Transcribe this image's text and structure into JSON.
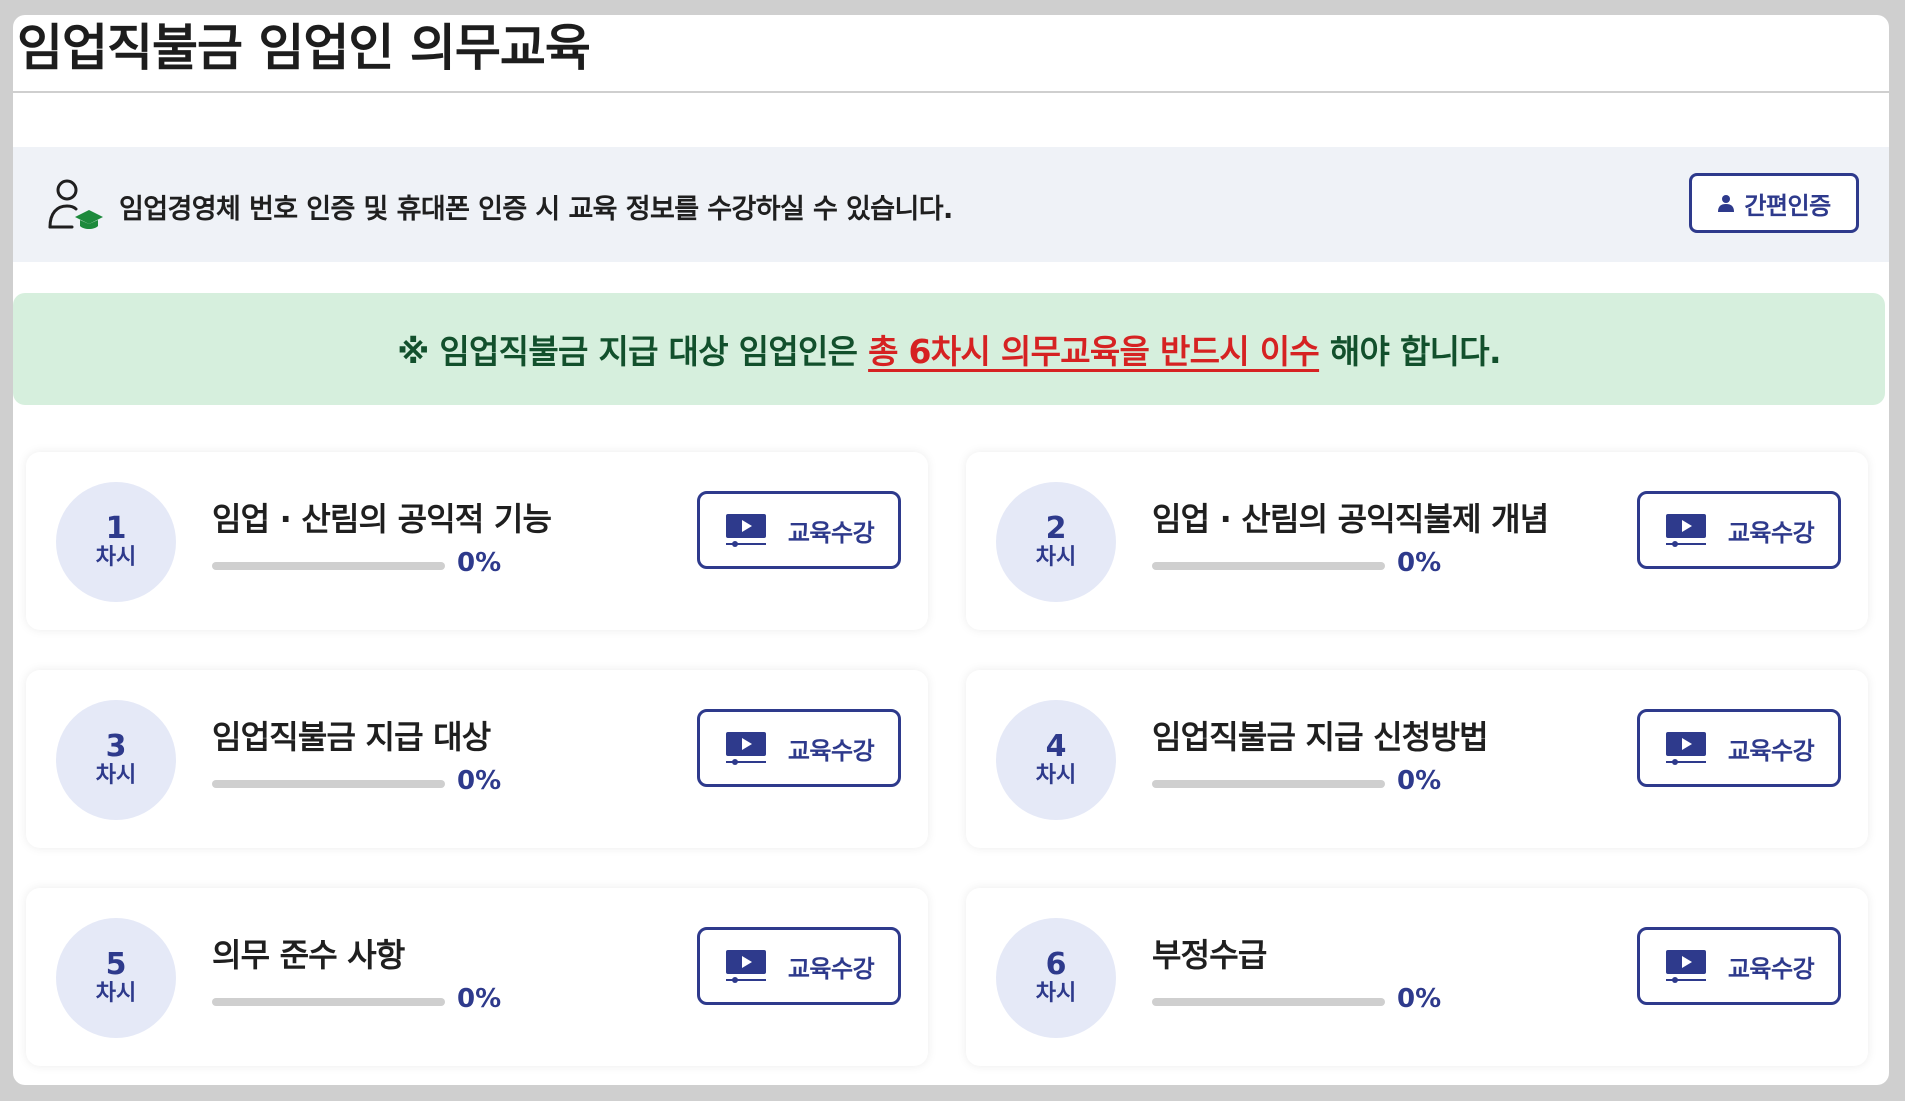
{
  "page": {
    "title": "임업직불금 임업인 의무교육"
  },
  "auth": {
    "icon": "user-graduate-icon",
    "message": "임업경영체 번호 인증 및 휴대폰 인증 시 교육 정보를 수강하실 수 있습니다.",
    "button_label": "간편인증",
    "button_icon": "person-icon"
  },
  "notice": {
    "prefix": "※ 임업직불금 지급 대상 임업인은 ",
    "emphasis": "총 6차시 의무교육을 반드시 이수",
    "suffix": " 해야 합니다."
  },
  "lesson_unit": "차시",
  "watch_label": "교육수강",
  "watch_icon": "video-play-icon",
  "colors": {
    "accent": "#2e3a8c",
    "notice_bg": "#d6efdd",
    "notice_text": "#12502c",
    "emphasis": "#d62222"
  },
  "lessons": [
    {
      "number": "1",
      "title": "임업 · 산림의 공익적 기능",
      "progress_text": "0%",
      "progress": 0
    },
    {
      "number": "2",
      "title": "임업 · 산림의 공익직불제 개념",
      "progress_text": "0%",
      "progress": 0
    },
    {
      "number": "3",
      "title": "임업직불금 지급 대상",
      "progress_text": "0%",
      "progress": 0
    },
    {
      "number": "4",
      "title": "임업직불금 지급 신청방법",
      "progress_text": "0%",
      "progress": 0
    },
    {
      "number": "5",
      "title": "의무 준수 사항",
      "progress_text": "0%",
      "progress": 0
    },
    {
      "number": "6",
      "title": "부정수급",
      "progress_text": "0%",
      "progress": 0
    }
  ]
}
